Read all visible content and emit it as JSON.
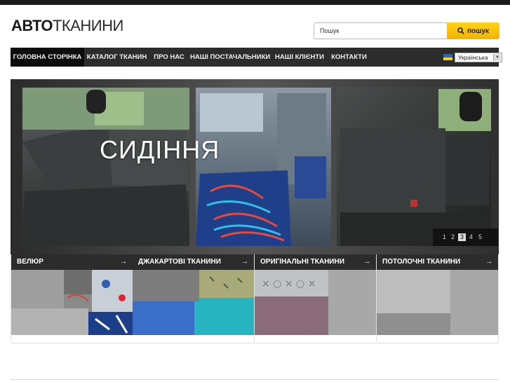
{
  "header": {
    "logo_bold": "АВТО",
    "logo_light": "ТКАНИНИ"
  },
  "search": {
    "value": "Пошук",
    "button_label": "пошук",
    "icon": "search-icon"
  },
  "nav": {
    "items": [
      {
        "label": "ГОЛОВНА СТОРІНКА",
        "active": true
      },
      {
        "label": "КАТАЛОГ ТКАНИН"
      },
      {
        "label": "ПРО НАС"
      },
      {
        "label": "НАШІ ПОСТАЧАЛЬНИКИ"
      },
      {
        "label": "НАШІ КЛІЄНТИ"
      },
      {
        "label": "КОНТАКТИ"
      }
    ],
    "language": "Українська",
    "language_icon": "ukraine-flag-icon"
  },
  "slider": {
    "caption": "СИДІННЯ",
    "pages": [
      "1",
      "2",
      "3",
      "4",
      "5"
    ],
    "active_page": "3"
  },
  "categories": [
    {
      "title": "ВЕЛЮР",
      "arrow": "→"
    },
    {
      "title": "ДЖАКАРТОВІ ТКАНИНИ",
      "arrow": "→"
    },
    {
      "title": "ОРИГІНАЛЬНІ ТКАНИНИ",
      "arrow": "→"
    },
    {
      "title": "ПОТОЛОЧНІ ТКАНИНИ",
      "arrow": "→"
    }
  ],
  "colors": {
    "accent": "#f2b400",
    "nav_bg": "#2c2c2c",
    "nav_active": "#0c0c0c"
  }
}
